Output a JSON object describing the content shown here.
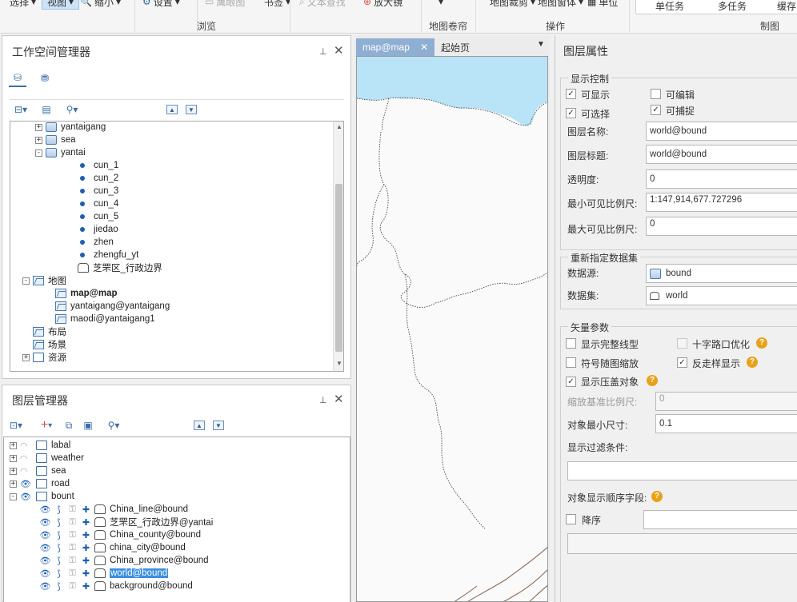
{
  "ribbon": {
    "buttons": [
      "选择",
      "视图",
      "缩小",
      "设置",
      "鹰眼图",
      "书签",
      "文本查找",
      "放大镜",
      "地图裁剪",
      "地图窗体",
      "单位"
    ],
    "groups": [
      "浏览",
      "地图卷帘",
      "操作",
      "制图"
    ],
    "tabs": [
      "单任务",
      "多任务",
      "缓存"
    ]
  },
  "workspace": {
    "title": "工作空间管理器",
    "nodes": [
      {
        "label": "yantaigang",
        "type": "datasource",
        "expander": "+"
      },
      {
        "label": "sea",
        "type": "datasource",
        "expander": "+"
      },
      {
        "label": "yantai",
        "type": "datasource",
        "expander": "-"
      },
      {
        "label": "cun_1",
        "type": "point"
      },
      {
        "label": "cun_2",
        "type": "point"
      },
      {
        "label": "cun_3",
        "type": "point"
      },
      {
        "label": "cun_4",
        "type": "point"
      },
      {
        "label": "cun_5",
        "type": "point"
      },
      {
        "label": "jiedao",
        "type": "point"
      },
      {
        "label": "zhen",
        "type": "point"
      },
      {
        "label": "zhengfu_yt",
        "type": "point"
      },
      {
        "label": "芝罘区_行政边界",
        "type": "region"
      },
      {
        "label": "地图",
        "type": "maps",
        "expander": "-"
      },
      {
        "label": "map@map",
        "type": "map",
        "bold": true
      },
      {
        "label": "yantaigang@yantaigang",
        "type": "map"
      },
      {
        "label": "maodi@yantaigang1",
        "type": "map"
      },
      {
        "label": "布局",
        "type": "layout"
      },
      {
        "label": "场景",
        "type": "scene"
      },
      {
        "label": "资源",
        "type": "resource",
        "expander": "+"
      }
    ]
  },
  "layers": {
    "title": "图层管理器",
    "groups": [
      {
        "label": "labal",
        "visible": false
      },
      {
        "label": "weather",
        "visible": false
      },
      {
        "label": "sea",
        "visible": false
      },
      {
        "label": "road",
        "visible": true
      },
      {
        "label": "bount",
        "visible": true,
        "expanded": true
      }
    ],
    "items": [
      {
        "label": "China_line@bound",
        "selected": false
      },
      {
        "label": "芝罘区_行政边界@yantai",
        "selected": false
      },
      {
        "label": "China_county@bound",
        "selected": false
      },
      {
        "label": "china_city@bound",
        "selected": false
      },
      {
        "label": "China_province@bound",
        "selected": false
      },
      {
        "label": "world@bound",
        "selected": true
      },
      {
        "label": "background@bound",
        "selected": false
      }
    ]
  },
  "map": {
    "tabs": [
      "map@map",
      "起始页"
    ],
    "sea_color": "#b9e3f7",
    "road_color": "#8a6a55"
  },
  "props": {
    "title": "图层属性",
    "display_control": {
      "legend": "显示控制",
      "visible": "可显示",
      "editable": "可编辑",
      "selectable": "可选择",
      "snappable": "可捕捉",
      "name_label": "图层名称:",
      "name_value": "world@bound",
      "caption_label": "图层标题:",
      "caption_value": "world@bound",
      "opacity_label": "透明度:",
      "opacity_value": "0",
      "min_scale_label": "最小可见比例尺:",
      "min_scale_value": "1:147,914,677.727296",
      "max_scale_label": "最大可见比例尺:",
      "max_scale_value": "0"
    },
    "dataset": {
      "legend": "重新指定数据集",
      "datasource_label": "数据源:",
      "datasource_value": "bound",
      "dataset_label": "数据集:",
      "dataset_value": "world"
    },
    "vector": {
      "legend": "矢量参数",
      "full_line": "显示完整线型",
      "cross_opt": "十字路口优化",
      "symbol_scale": "符号随图缩放",
      "antialias": "反走样显示",
      "overlap": "显示压盖对象",
      "base_scale_label": "缩放基准比例尺:",
      "base_scale_value": "0",
      "min_size_label": "对象最小尺寸:",
      "min_size_value": "0.1",
      "filter_label": "显示过滤条件:",
      "order_label": "对象显示顺序字段:",
      "desc_label": "降序"
    }
  }
}
